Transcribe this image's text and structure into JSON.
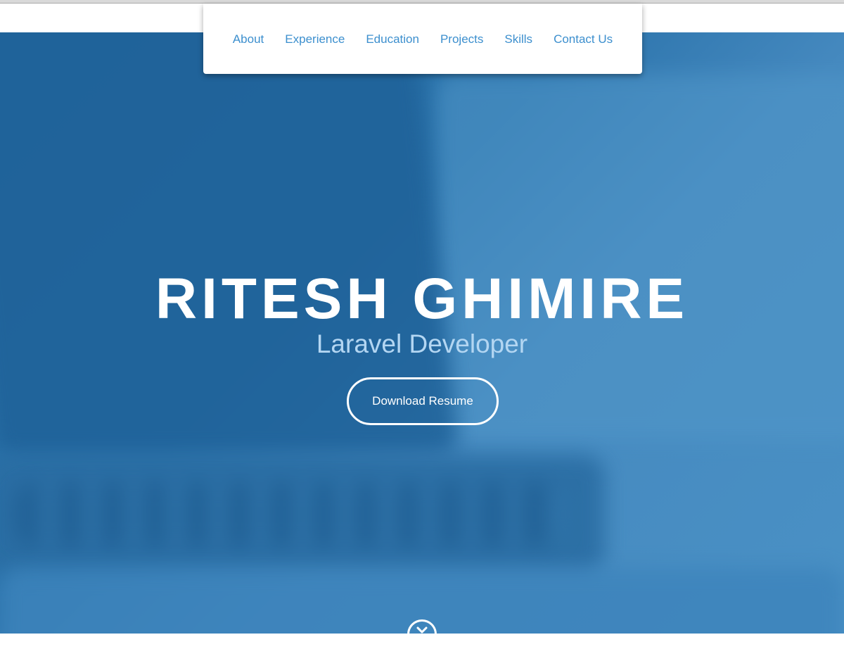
{
  "nav": {
    "items": [
      {
        "label": "About"
      },
      {
        "label": "Experience"
      },
      {
        "label": "Education"
      },
      {
        "label": "Projects"
      },
      {
        "label": "Skills"
      },
      {
        "label": "Contact Us"
      }
    ]
  },
  "hero": {
    "name": "RITESH GHIMIRE",
    "role": "Laravel Developer",
    "download_label": "Download Resume",
    "scroll_icon": "chevron-down-icon"
  },
  "colors": {
    "accent": "#3c8fce",
    "hero_overlay": "#2c74ac",
    "subtitle": "#b3d6f2"
  }
}
